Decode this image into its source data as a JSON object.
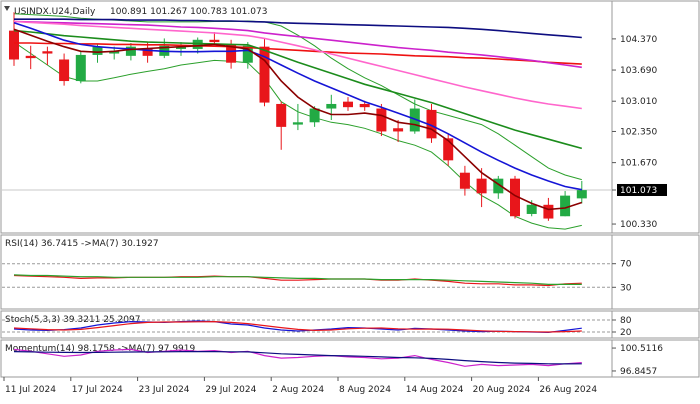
{
  "header": {
    "symbol": "USINDX.U24,Daily",
    "ohlc": "100.891 101.267 100.783 101.073"
  },
  "colors": {
    "bull": "#22aa44",
    "bear": "#e8161b",
    "ma_fast": "#8b0000",
    "ma_blue": "#1515d6",
    "ma_green": "#1c8c1c",
    "ma_pink": "#ff66cc",
    "ma_magenta": "#cc22cc",
    "ma_navy": "#0d0d80",
    "ma_red": "#ee1111",
    "bb": "#2ca02c"
  },
  "chart_data": [
    {
      "type": "candlestick",
      "title": "USINDX.U24,Daily",
      "price_labels": [
        "104.370",
        "103.690",
        "103.010",
        "102.350",
        "101.670",
        "101.073",
        "100.330"
      ],
      "ylim": [
        100.2,
        105.0
      ],
      "last_price": 101.073,
      "x_tick_labels": [
        {
          "label": "11 Jul 2024",
          "index": 0
        },
        {
          "label": "17 Jul 2024",
          "index": 4
        },
        {
          "label": "23 Jul 2024",
          "index": 8
        },
        {
          "label": "29 Jul 2024",
          "index": 12
        },
        {
          "label": "2 Aug 2024",
          "index": 16
        },
        {
          "label": "8 Aug 2024",
          "index": 20
        },
        {
          "label": "14 Aug 2024",
          "index": 24
        },
        {
          "label": "20 Aug 2024",
          "index": 28
        },
        {
          "label": "26 Aug 2024",
          "index": 32
        }
      ],
      "candles": [
        {
          "o": 104.55,
          "h": 104.95,
          "l": 103.78,
          "c": 103.92
        },
        {
          "o": 104.0,
          "h": 104.22,
          "l": 103.71,
          "c": 103.95
        },
        {
          "o": 104.1,
          "h": 104.2,
          "l": 103.8,
          "c": 104.05
        },
        {
          "o": 103.92,
          "h": 104.05,
          "l": 103.35,
          "c": 103.45
        },
        {
          "o": 103.45,
          "h": 104.1,
          "l": 103.4,
          "c": 104.02
        },
        {
          "o": 104.02,
          "h": 104.25,
          "l": 103.85,
          "c": 104.2
        },
        {
          "o": 104.05,
          "h": 104.2,
          "l": 103.92,
          "c": 104.1
        },
        {
          "o": 104.0,
          "h": 104.28,
          "l": 103.9,
          "c": 104.2
        },
        {
          "o": 104.15,
          "h": 104.3,
          "l": 103.85,
          "c": 104.0
        },
        {
          "o": 104.0,
          "h": 104.38,
          "l": 103.95,
          "c": 104.22
        },
        {
          "o": 104.15,
          "h": 104.3,
          "l": 104.0,
          "c": 104.2
        },
        {
          "o": 104.15,
          "h": 104.4,
          "l": 104.05,
          "c": 104.35
        },
        {
          "o": 104.35,
          "h": 104.52,
          "l": 104.25,
          "c": 104.3
        },
        {
          "o": 104.25,
          "h": 104.35,
          "l": 103.72,
          "c": 103.85
        },
        {
          "o": 103.85,
          "h": 104.3,
          "l": 103.72,
          "c": 104.22
        },
        {
          "o": 104.2,
          "h": 104.38,
          "l": 102.9,
          "c": 102.98
        },
        {
          "o": 102.95,
          "h": 103.0,
          "l": 101.95,
          "c": 102.45
        },
        {
          "o": 102.5,
          "h": 102.95,
          "l": 102.38,
          "c": 102.55
        },
        {
          "o": 102.55,
          "h": 102.9,
          "l": 102.45,
          "c": 102.85
        },
        {
          "o": 102.85,
          "h": 103.15,
          "l": 102.6,
          "c": 102.95
        },
        {
          "o": 103.0,
          "h": 103.1,
          "l": 102.8,
          "c": 102.88
        },
        {
          "o": 102.95,
          "h": 103.02,
          "l": 102.8,
          "c": 102.88
        },
        {
          "o": 102.85,
          "h": 102.95,
          "l": 102.25,
          "c": 102.35
        },
        {
          "o": 102.42,
          "h": 102.6,
          "l": 102.12,
          "c": 102.35
        },
        {
          "o": 102.35,
          "h": 103.05,
          "l": 102.3,
          "c": 102.85
        },
        {
          "o": 102.82,
          "h": 102.95,
          "l": 102.1,
          "c": 102.2
        },
        {
          "o": 102.2,
          "h": 102.3,
          "l": 101.6,
          "c": 101.72
        },
        {
          "o": 101.45,
          "h": 101.6,
          "l": 100.95,
          "c": 101.1
        },
        {
          "o": 101.32,
          "h": 101.55,
          "l": 100.7,
          "c": 101.0
        },
        {
          "o": 101.0,
          "h": 101.38,
          "l": 100.88,
          "c": 101.32
        },
        {
          "o": 101.32,
          "h": 101.38,
          "l": 100.45,
          "c": 100.5
        },
        {
          "o": 100.55,
          "h": 100.85,
          "l": 100.5,
          "c": 100.75
        },
        {
          "o": 100.75,
          "h": 100.9,
          "l": 100.4,
          "c": 100.45
        },
        {
          "o": 100.5,
          "h": 101.05,
          "l": 100.5,
          "c": 100.95
        },
        {
          "o": 100.89,
          "h": 101.27,
          "l": 100.78,
          "c": 101.07
        }
      ],
      "moving_averages": [
        {
          "color_key": "ma_navy",
          "values": [
            104.8,
            104.8,
            104.8,
            104.8,
            104.79,
            104.79,
            104.79,
            104.78,
            104.78,
            104.78,
            104.77,
            104.77,
            104.76,
            104.76,
            104.75,
            104.74,
            104.72,
            104.71,
            104.7,
            104.69,
            104.68,
            104.67,
            104.66,
            104.65,
            104.64,
            104.63,
            104.62,
            104.6,
            104.58,
            104.55,
            104.52,
            104.49,
            104.46,
            104.43,
            104.4
          ]
        },
        {
          "color_key": "ma_red",
          "values": [
            104.28,
            104.28,
            104.27,
            104.27,
            104.26,
            104.26,
            104.25,
            104.25,
            104.24,
            104.24,
            104.23,
            104.22,
            104.21,
            104.2,
            104.18,
            104.16,
            104.14,
            104.12,
            104.1,
            104.08,
            104.06,
            104.05,
            104.04,
            104.02,
            104.0,
            103.99,
            103.98,
            103.96,
            103.95,
            103.93,
            103.91,
            103.89,
            103.86,
            103.84,
            103.82
          ]
        },
        {
          "color_key": "ma_magenta",
          "values": [
            104.75,
            104.74,
            104.73,
            104.72,
            104.71,
            104.7,
            104.69,
            104.68,
            104.67,
            104.65,
            104.63,
            104.62,
            104.6,
            104.58,
            104.55,
            104.5,
            104.46,
            104.42,
            104.38,
            104.34,
            104.3,
            104.26,
            104.22,
            104.18,
            104.15,
            104.12,
            104.08,
            104.05,
            104.02,
            103.98,
            103.94,
            103.9,
            103.85,
            103.8,
            103.75
          ]
        },
        {
          "color_key": "ma_pink",
          "values": [
            104.75,
            104.73,
            104.71,
            104.69,
            104.66,
            104.64,
            104.62,
            104.6,
            104.58,
            104.56,
            104.54,
            104.52,
            104.5,
            104.47,
            104.44,
            104.38,
            104.3,
            104.22,
            104.13,
            104.04,
            103.95,
            103.86,
            103.77,
            103.68,
            103.59,
            103.5,
            103.41,
            103.32,
            103.24,
            103.16,
            103.08,
            103.01,
            102.95,
            102.9,
            102.85
          ]
        },
        {
          "color_key": "ma_green",
          "values": [
            104.55,
            104.52,
            104.48,
            104.44,
            104.41,
            104.38,
            104.35,
            104.32,
            104.3,
            104.29,
            104.28,
            104.27,
            104.26,
            104.25,
            104.24,
            104.12,
            103.99,
            103.86,
            103.74,
            103.62,
            103.5,
            103.38,
            103.28,
            103.18,
            103.08,
            102.98,
            102.86,
            102.74,
            102.62,
            102.5,
            102.38,
            102.28,
            102.18,
            102.08,
            101.98
          ]
        },
        {
          "color_key": "ma_blue",
          "values": [
            104.72,
            104.6,
            104.47,
            104.34,
            104.25,
            104.2,
            104.17,
            104.15,
            104.12,
            104.1,
            104.09,
            104.09,
            104.1,
            104.1,
            104.12,
            103.98,
            103.8,
            103.62,
            103.45,
            103.3,
            103.15,
            103.0,
            102.88,
            102.75,
            102.62,
            102.48,
            102.3,
            102.1,
            101.9,
            101.72,
            101.55,
            101.4,
            101.27,
            101.15,
            101.08
          ]
        },
        {
          "color_key": "ma_fast",
          "values": [
            104.58,
            104.45,
            104.32,
            104.2,
            104.1,
            104.08,
            104.1,
            104.14,
            104.16,
            104.18,
            104.2,
            104.22,
            104.25,
            104.2,
            104.15,
            103.9,
            103.45,
            103.1,
            102.85,
            102.72,
            102.72,
            102.75,
            102.7,
            102.55,
            102.5,
            102.4,
            102.15,
            101.8,
            101.45,
            101.2,
            100.95,
            100.78,
            100.65,
            100.68,
            100.8
          ]
        },
        {
          "color_key": "bb",
          "values": [
            104.92,
            104.9,
            104.88,
            104.86,
            104.82,
            104.8,
            104.78,
            104.76,
            104.74,
            104.74,
            104.74,
            104.74,
            104.75,
            104.75,
            104.76,
            104.74,
            104.65,
            104.45,
            104.22,
            103.95,
            103.72,
            103.52,
            103.35,
            103.15,
            102.95,
            102.8,
            102.7,
            102.6,
            102.5,
            102.3,
            102.05,
            101.8,
            101.55,
            101.4,
            101.3
          ]
        },
        {
          "color_key": "bb",
          "values": [
            104.3,
            104.05,
            103.8,
            103.55,
            103.45,
            103.45,
            103.52,
            103.6,
            103.66,
            103.72,
            103.8,
            103.85,
            103.9,
            103.88,
            103.85,
            103.5,
            103.0,
            102.78,
            102.65,
            102.55,
            102.5,
            102.42,
            102.3,
            102.15,
            102.05,
            101.9,
            101.6,
            101.25,
            100.95,
            100.75,
            100.5,
            100.35,
            100.25,
            100.22,
            100.3
          ]
        }
      ]
    },
    {
      "type": "line",
      "title": "RSI(14) 36.7415 ->MA(7) 30.1927",
      "tick_labels": [
        "70",
        "30"
      ],
      "ylim": [
        0,
        100
      ],
      "levels": [
        70,
        30
      ],
      "series": [
        {
          "color_key": "bear",
          "values": [
            50,
            49,
            48,
            47,
            45,
            46,
            46,
            47,
            47,
            47,
            48,
            48,
            49,
            48,
            48,
            45,
            42,
            42,
            43,
            44,
            44,
            44,
            42,
            42,
            44,
            42,
            40,
            37,
            36,
            36,
            34,
            34,
            33,
            36,
            37
          ]
        },
        {
          "color_key": "bb",
          "values": [
            51,
            50,
            50,
            49,
            48,
            48,
            47,
            47,
            47,
            47,
            47,
            47,
            48,
            48,
            48,
            47,
            46,
            45,
            45,
            44,
            44,
            44,
            43,
            43,
            43,
            43,
            42,
            41,
            40,
            39,
            38,
            37,
            35,
            35,
            35
          ]
        }
      ]
    },
    {
      "type": "line",
      "title": "Stoch(5,3,3) 39.3211 25.2097",
      "tick_labels": [
        "80",
        "20"
      ],
      "ylim": [
        0,
        100
      ],
      "levels": [
        80,
        20
      ],
      "series": [
        {
          "color_key": "ma_blue",
          "values": [
            35,
            30,
            28,
            32,
            40,
            55,
            65,
            72,
            70,
            68,
            72,
            75,
            72,
            60,
            55,
            40,
            30,
            25,
            30,
            35,
            42,
            40,
            35,
            30,
            38,
            35,
            30,
            25,
            22,
            24,
            22,
            20,
            18,
            28,
            39
          ]
        },
        {
          "color_key": "bear",
          "values": [
            40,
            36,
            32,
            30,
            33,
            42,
            52,
            62,
            68,
            70,
            70,
            71,
            72,
            68,
            62,
            52,
            42,
            33,
            28,
            30,
            36,
            39,
            40,
            36,
            34,
            35,
            34,
            30,
            26,
            23,
            22,
            21,
            20,
            22,
            25
          ]
        }
      ]
    },
    {
      "type": "line",
      "title": "Momentum(14) 98.1758 ->MA(7) 97.9919",
      "tick_labels": [
        "100.5116",
        "96.8457"
      ],
      "ylim": [
        96.2,
        101.0
      ],
      "series": [
        {
          "color_key": "ma_magenta",
          "values": [
            100.3,
            100.0,
            99.6,
            99.2,
            99.4,
            100.0,
            100.2,
            100.3,
            99.8,
            100.0,
            100.2,
            100.0,
            100.1,
            99.8,
            100.0,
            99.3,
            98.9,
            99.0,
            99.2,
            99.3,
            99.1,
            99.0,
            98.8,
            98.9,
            99.3,
            98.7,
            98.2,
            97.6,
            97.9,
            97.7,
            97.8,
            97.9,
            97.7,
            98.0,
            98.18
          ]
        },
        {
          "color_key": "ma_navy",
          "values": [
            99.95,
            99.9,
            99.85,
            99.82,
            99.8,
            99.82,
            99.85,
            99.88,
            99.9,
            99.92,
            99.95,
            99.95,
            99.95,
            99.92,
            99.9,
            99.75,
            99.6,
            99.5,
            99.4,
            99.3,
            99.25,
            99.2,
            99.1,
            99.0,
            98.95,
            98.85,
            98.7,
            98.5,
            98.35,
            98.2,
            98.1,
            98.05,
            98.0,
            97.98,
            97.99
          ]
        }
      ]
    }
  ]
}
